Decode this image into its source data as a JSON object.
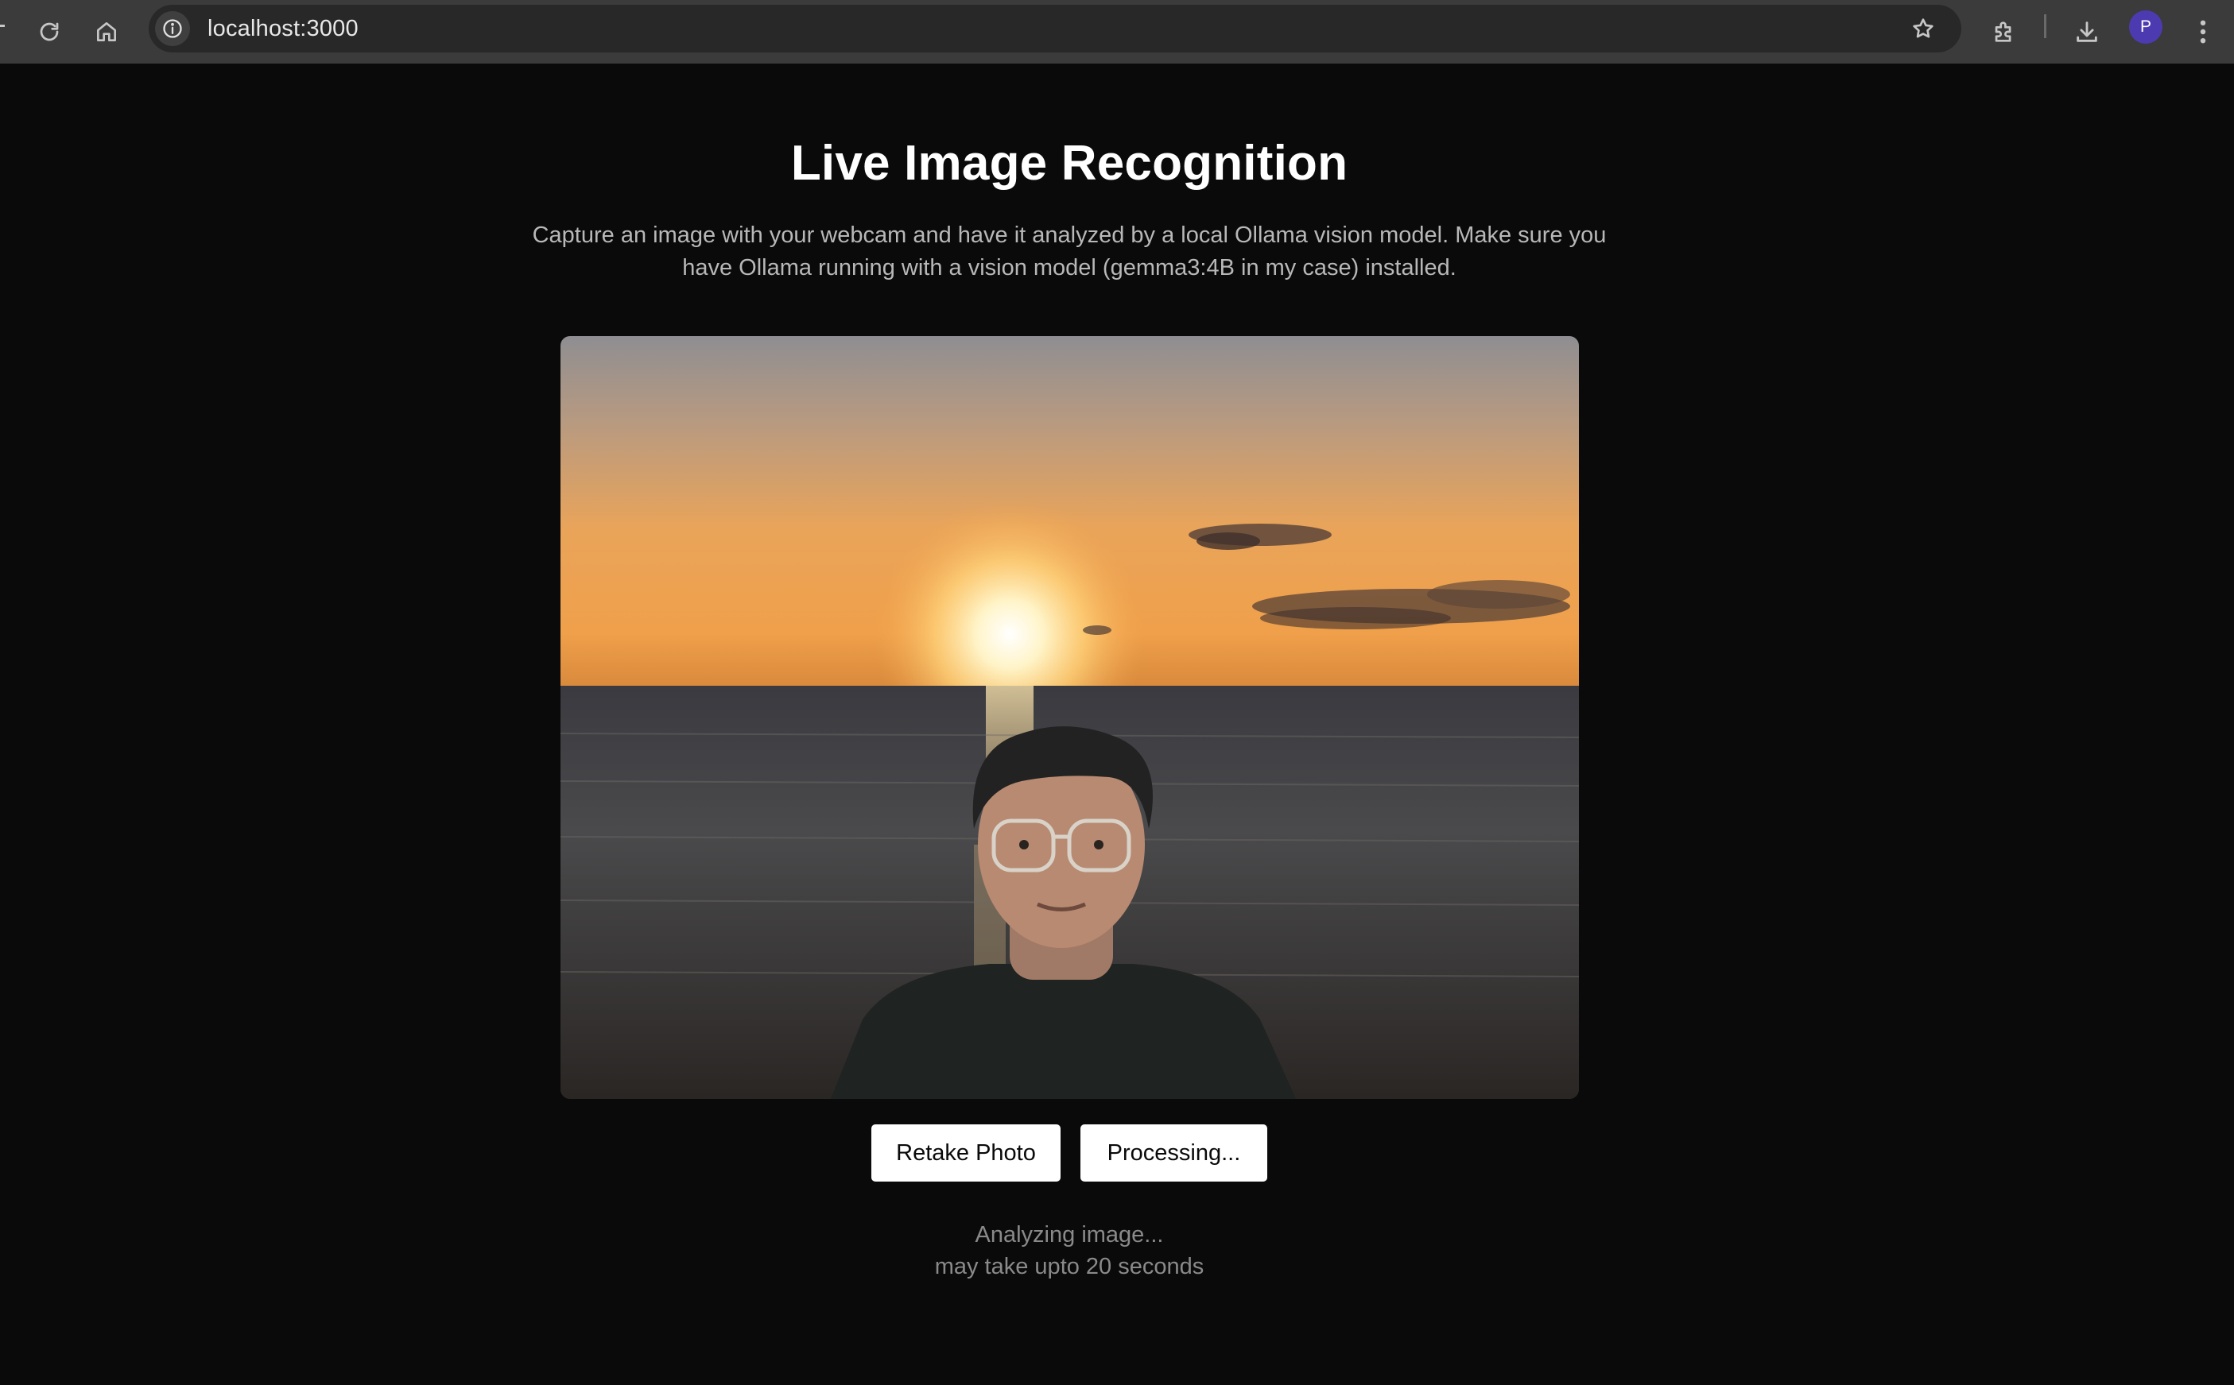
{
  "browser": {
    "url": "localhost:3000",
    "avatar_letter": "P",
    "avatar_color": "#4c3bb0",
    "icons": [
      "reload-icon",
      "home-icon",
      "site-info-icon",
      "bookmark-star-icon",
      "extensions-icon",
      "download-icon",
      "menu-icon"
    ]
  },
  "page": {
    "title": "Live Image Recognition",
    "description": "Capture an image with your webcam and have it analyzed by a local Ollama vision model. Make sure you have Ollama running with a vision model (gemma3:4B in my case) installed."
  },
  "capture": {
    "image_description": "webcam capture: person in front of sunset ocean background"
  },
  "actions": {
    "retake_label": "Retake Photo",
    "process_label": "Processing..."
  },
  "status": {
    "line1": "Analyzing image...",
    "line2": "may take upto 20 seconds"
  },
  "colors": {
    "background": "#0a0a0a",
    "toolbar": "#3b3b3b",
    "button_bg": "#ffffff",
    "muted_text": "#8a8a8a"
  }
}
